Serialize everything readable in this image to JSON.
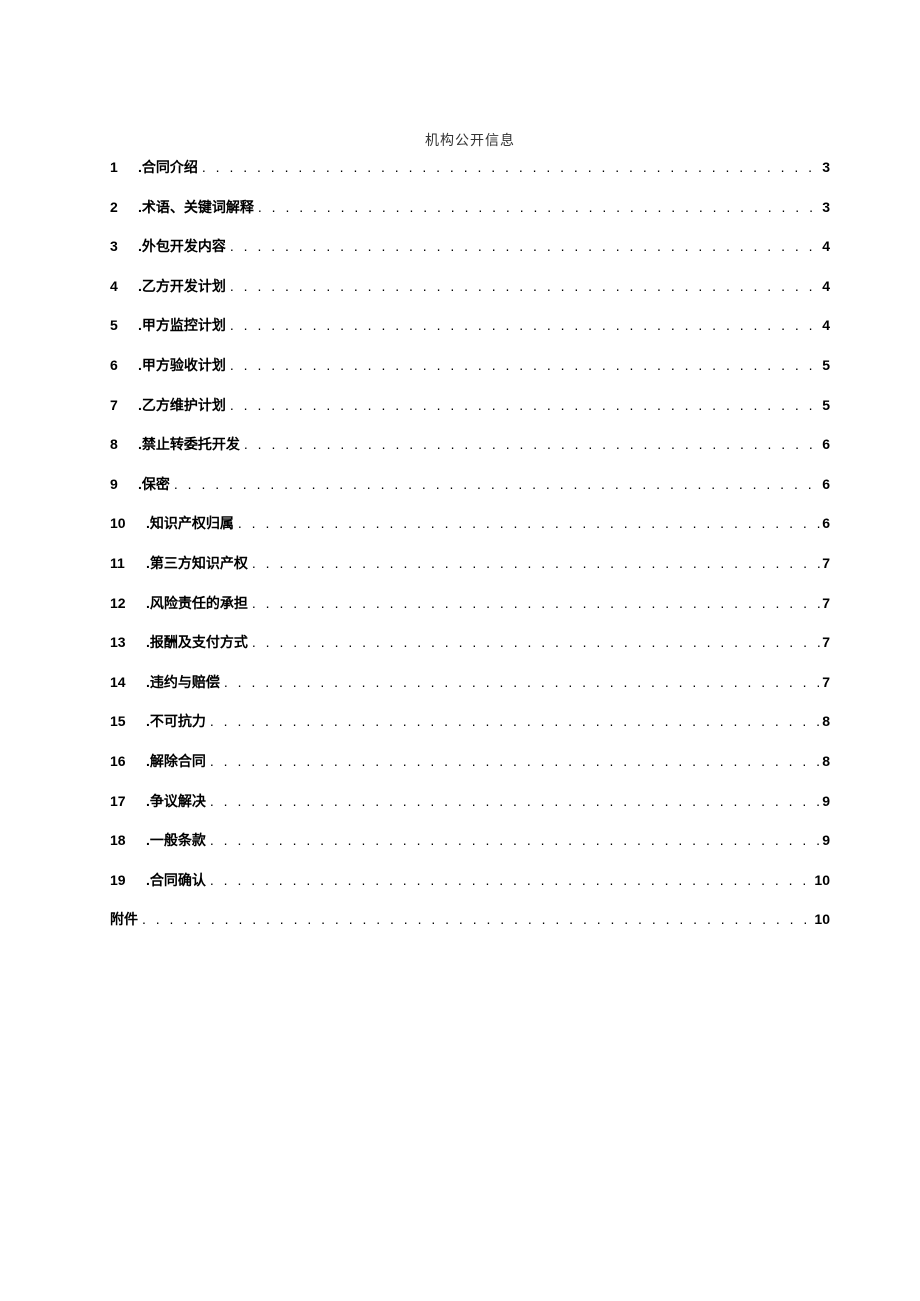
{
  "header": {
    "title": "机构公开信息"
  },
  "toc": {
    "items": [
      {
        "num": "1",
        "title": ".合同介绍",
        "page": "3"
      },
      {
        "num": "2",
        "title": ".术语、关键词解释",
        "page": "3"
      },
      {
        "num": "3",
        "title": ".外包开发内容",
        "page": "4"
      },
      {
        "num": "4",
        "title": ".乙方开发计划",
        "page": "4"
      },
      {
        "num": "5",
        "title": ".甲方监控计划",
        "page": "4"
      },
      {
        "num": "6",
        "title": ".甲方验收计划",
        "page": "5"
      },
      {
        "num": "7",
        "title": ".乙方维护计划",
        "page": "5"
      },
      {
        "num": "8",
        "title": ".禁止转委托开发",
        "page": "6"
      },
      {
        "num": "9",
        "title": ".保密",
        "page": "6"
      },
      {
        "num": "10",
        "title": ".知识产权归属",
        "page": "6"
      },
      {
        "num": "11",
        "title": ".第三方知识产权",
        "page": "7"
      },
      {
        "num": "12",
        "title": ".风险责任的承担",
        "page": "7"
      },
      {
        "num": "13",
        "title": ".报酬及支付方式",
        "page": "7"
      },
      {
        "num": "14",
        "title": ".违约与赔偿",
        "page": "7"
      },
      {
        "num": "15",
        "title": ".不可抗力",
        "page": "8"
      },
      {
        "num": "16",
        "title": ".解除合同",
        "page": "8"
      },
      {
        "num": "17",
        "title": ".争议解决",
        "page": "9"
      },
      {
        "num": "18",
        "title": ".一般条款",
        "page": "9"
      },
      {
        "num": "19",
        "title": ".合同确认",
        "page": "10"
      }
    ],
    "appendix": {
      "title": "附件",
      "page": "10"
    }
  }
}
